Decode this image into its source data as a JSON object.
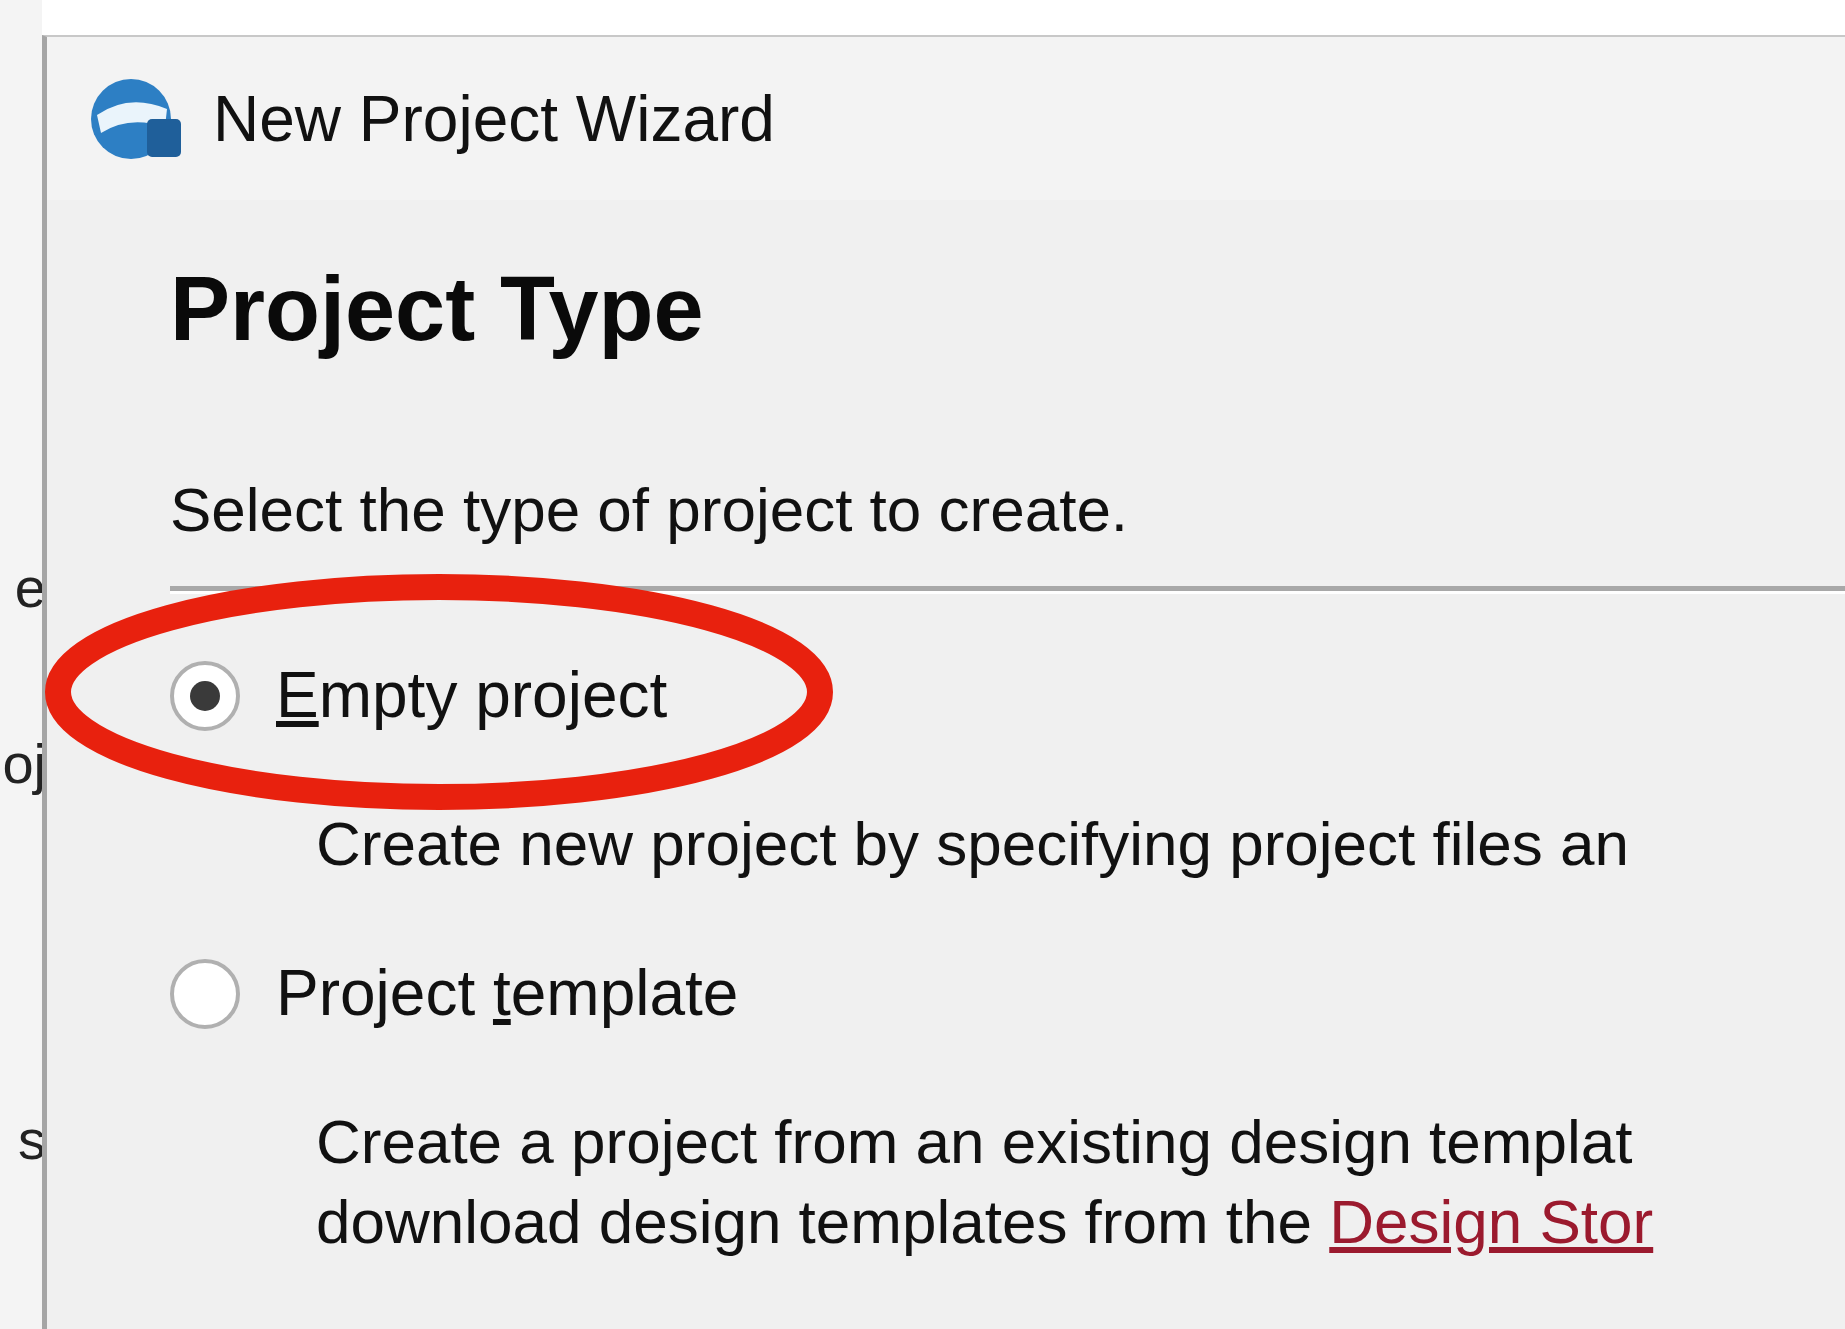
{
  "background_window": {
    "fragments": [
      "e",
      "oj",
      "s"
    ]
  },
  "dialog": {
    "title": "New Project Wizard",
    "heading": "Project Type",
    "instruction": "Select the type of project to create.",
    "options": [
      {
        "label": {
          "key": "E",
          "after": "mpty project"
        },
        "selected": true,
        "circled": true,
        "description_lines": [
          {
            "text": "Create new project by specifying project files an"
          }
        ]
      },
      {
        "label": {
          "before": "Project ",
          "key": "t",
          "after": "emplate"
        },
        "selected": false,
        "circled": false,
        "description_lines": [
          {
            "text": "Create a project from an existing design templat"
          },
          {
            "text": "download design templates from the ",
            "link": "Design Stor"
          }
        ]
      }
    ]
  }
}
